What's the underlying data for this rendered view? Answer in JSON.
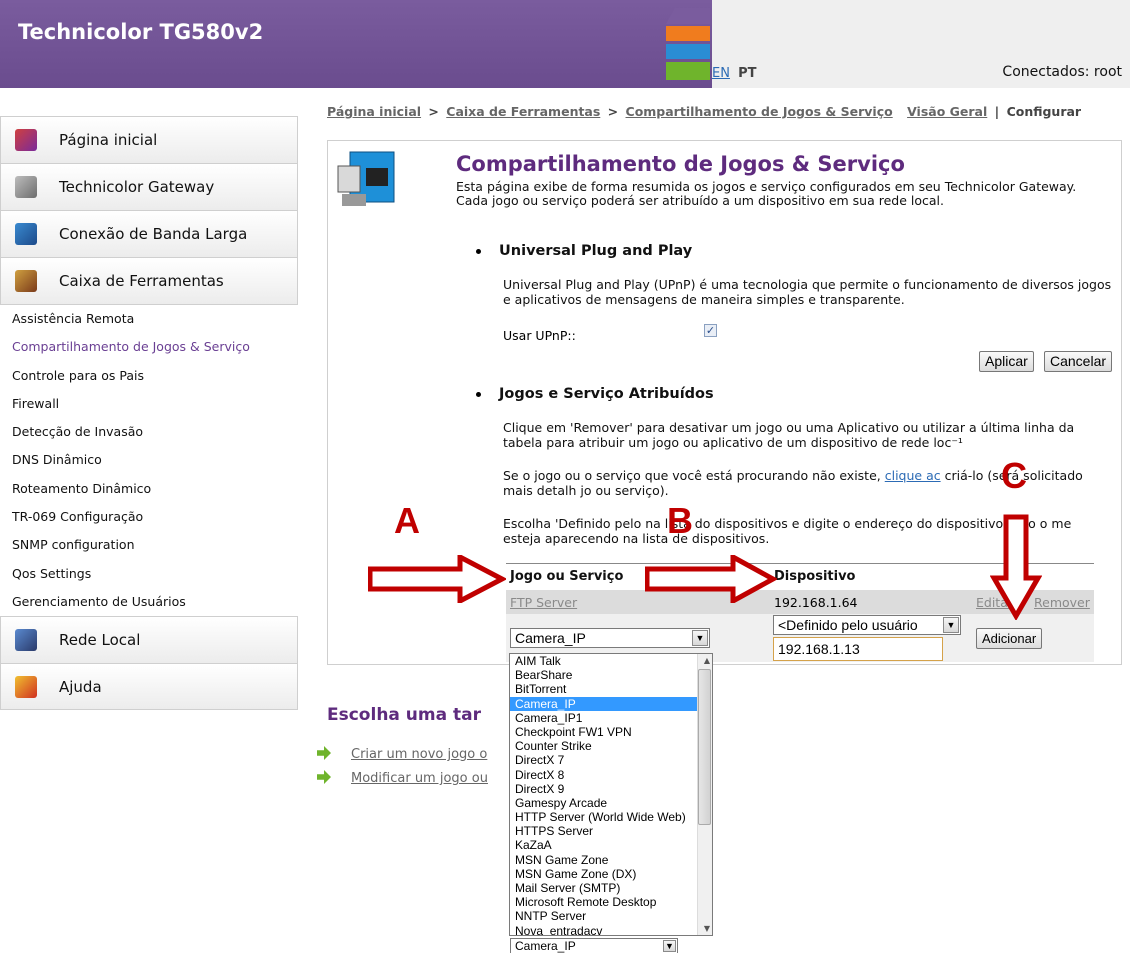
{
  "header": {
    "title": "Technicolor TG580v2",
    "lang_en": "EN",
    "lang_pt": "PT",
    "connected": "Conectados: root"
  },
  "breadcrumb": {
    "home": "Página inicial",
    "toolbox": "Caixa de Ferramentas",
    "current": "Compartilhamento de Jogos & Serviço",
    "overview": "Visão Geral",
    "sep": "|",
    "configure": "Configurar"
  },
  "sidebar": {
    "main_items": [
      {
        "label": "Página inicial",
        "icon": "house-icon",
        "color": "#c0392b"
      },
      {
        "label": "Technicolor Gateway",
        "icon": "gateway-icon",
        "color": "#8a8a8a"
      },
      {
        "label": "Conexão de Banda Larga",
        "icon": "globe-icon",
        "color": "#2a6fb0"
      },
      {
        "label": "Caixa de Ferramentas",
        "icon": "toolbox-icon",
        "color": "#b05a2a"
      }
    ],
    "sub_items": [
      "Assistência Remota",
      "Compartilhamento de Jogos & Serviço",
      "Controle para os Pais",
      "Firewall",
      "Detecção de Invasão",
      "DNS Dinâmico",
      "Roteamento Dinâmico",
      "TR-069 Configuração",
      "SNMP configuration",
      "Qos Settings",
      "Gerenciamento de Usuários"
    ],
    "bottom_items": [
      {
        "label": "Rede Local",
        "icon": "network-icon",
        "color": "#3a6fb0"
      },
      {
        "label": "Ajuda",
        "icon": "help-icon",
        "color": "#e0a020"
      }
    ]
  },
  "main": {
    "title": "Compartilhamento de Jogos & Serviço",
    "description": "Esta página exibe de forma resumida os jogos e serviço configurados em seu Technicolor Gateway. Cada jogo ou serviço poderá ser atribuído a um dispositivo em sua rede local.",
    "upnp": {
      "title": "Universal Plug and Play",
      "text": "Universal Plug and Play (UPnP) é uma tecnologia que permite o funcionamento de diversos jogos e aplicativos de mensagens de maneira simples e transparente.",
      "checkbox_label": "Usar UPnP::",
      "checked": "✓",
      "apply": "Aplicar",
      "cancel": "Cancelar"
    },
    "assigned": {
      "title": "Jogos e Serviço Atribuídos",
      "para1": "Clique em 'Remover' para desativar um jogo ou uma Aplicativo ou utilizar a última linha da tabela para atribuir um jogo ou aplicativo de um dispositivo de rede loc⁻¹",
      "para2_a": "Se o jogo ou o serviço que você está procurando não existe, ",
      "para2_link": "clique ac",
      "para2_b": " criá-lo (será solicitado mais detalh           jo ou serviço).",
      "para3": "Escolha 'Definido pelo          na lista do dispositivos e digite o endereço       do dispositivo,caso o me          esteja aparecendo na lista de dispositivos."
    },
    "table": {
      "col_game": "Jogo ou Serviço",
      "col_device": "Dispositivo",
      "row_game": "FTP Server",
      "row_ip": "192.168.1.64",
      "row_edit": "Editar",
      "row_remove": "Remover",
      "game_select_value": "Camera_IP",
      "device_select_value": "<Definido pelo usuário",
      "ip_value": "192.168.1.13",
      "add_button": "Adicionar",
      "behind_text": "Universal Plug and Play"
    },
    "dropdown": {
      "options": [
        "AIM Talk",
        "BearShare",
        "BitTorrent",
        "Camera_IP",
        "Camera_IP1",
        "Checkpoint FW1 VPN",
        "Counter Strike",
        "DirectX 7",
        "DirectX 8",
        "DirectX 9",
        "Gamespy Arcade",
        "HTTP Server (World Wide Web)",
        "HTTPS Server",
        "KaZaA",
        "MSN Game Zone",
        "MSN Game Zone (DX)",
        "Mail Server (SMTP)",
        "Microsoft Remote Desktop",
        "NNTP Server",
        "Nova_entradacv"
      ],
      "selected": "Camera_IP",
      "bottom_value": "Camera_IP"
    },
    "tasks": {
      "title": "Escolha uma tar",
      "items": [
        "Criar um novo jogo o",
        "Modificar um jogo ou"
      ]
    }
  },
  "annotations": {
    "a": "A",
    "b": "B",
    "c": "C",
    "color": "#c00000"
  }
}
